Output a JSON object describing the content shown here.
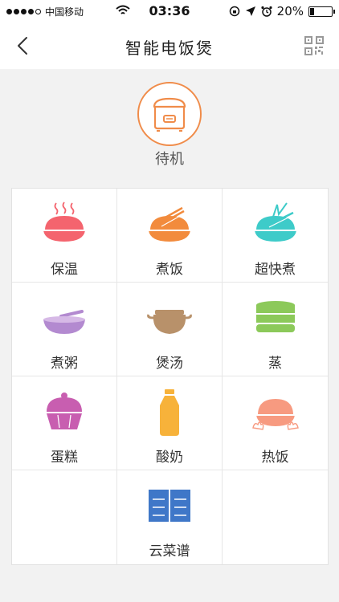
{
  "status_bar": {
    "carrier": "中国移动",
    "time": "03:36",
    "battery_pct": "20%",
    "battery_level": 0.2
  },
  "nav": {
    "title": "智能电饭煲",
    "back_icon": "chevron-left-icon",
    "qr_icon": "qr-code-icon"
  },
  "device": {
    "status": "待机",
    "accent": "#f08c4a"
  },
  "modes": [
    {
      "label": "保温",
      "icon": "keep-warm-icon",
      "color": "#f4646e"
    },
    {
      "label": "煮饭",
      "icon": "cook-rice-icon",
      "color": "#f28b3d"
    },
    {
      "label": "超快煮",
      "icon": "quick-cook-icon",
      "color": "#3ecbc9"
    },
    {
      "label": "煮粥",
      "icon": "porridge-icon",
      "color": "#b38ad0"
    },
    {
      "label": "煲汤",
      "icon": "soup-icon",
      "color": "#b8916a"
    },
    {
      "label": "蒸",
      "icon": "steam-icon",
      "color": "#8cc95a"
    },
    {
      "label": "蛋糕",
      "icon": "cake-icon",
      "color": "#c85eb0"
    },
    {
      "label": "酸奶",
      "icon": "yogurt-icon",
      "color": "#f7b23a"
    },
    {
      "label": "热饭",
      "icon": "reheat-icon",
      "color": "#f79a80"
    },
    {
      "label": "",
      "icon": "",
      "color": ""
    },
    {
      "label": "云菜谱",
      "icon": "cloud-recipe-icon",
      "color": "#3f77c8"
    },
    {
      "label": "",
      "icon": "",
      "color": ""
    }
  ]
}
